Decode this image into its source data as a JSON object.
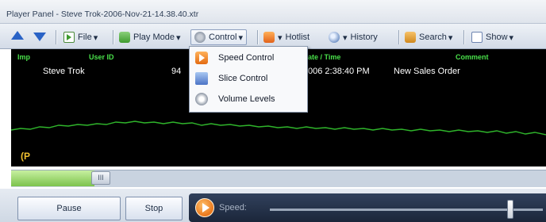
{
  "window": {
    "title": "Player Panel - Steve Trok-2006-Nov-21-14.38.40.xtr"
  },
  "toolbar": {
    "file_label": "File",
    "play_mode_label": "Play Mode",
    "control_label": "Control",
    "hotlist_label": "Hotlist",
    "history_label": "History",
    "search_label": "Search",
    "show_label": "Show",
    "dropdown_arrow": "▾"
  },
  "menu": {
    "items": [
      {
        "label": "Speed Control",
        "icon": "speed-control-icon"
      },
      {
        "label": "Slice Control",
        "icon": "slice-control-icon"
      },
      {
        "label": "Volume Levels",
        "icon": "volume-levels-icon"
      }
    ]
  },
  "table": {
    "headers": {
      "imp": "Imp",
      "user_id": "User ID",
      "date_time": "ate / Time",
      "comment": "Comment"
    },
    "row": {
      "user_id": "Steve Trok",
      "id_fragment": "94",
      "date_time": "006 2:38:40 PM",
      "comment": "New Sales Order"
    }
  },
  "marker": {
    "text": "(P"
  },
  "progress": {
    "fraction": 0.17,
    "grip_text": "III"
  },
  "controls": {
    "pause_label": "Pause",
    "stop_label": "Stop",
    "speed_label": "Speed:"
  },
  "speed": {
    "level": 0.88
  },
  "colors": {
    "accent_green": "#49e04a",
    "wave_green": "#2fb52b",
    "progress_green": "#7cc24d",
    "speed_orange": "#e8761b"
  }
}
